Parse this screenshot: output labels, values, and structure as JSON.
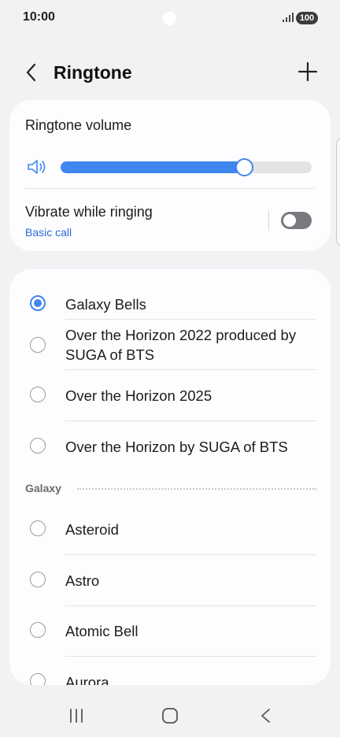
{
  "status": {
    "time": "10:00",
    "battery": "100"
  },
  "header": {
    "title": "Ringtone",
    "back_icon": "chevron-left-icon",
    "add_icon": "plus-icon"
  },
  "volume_card": {
    "volume_label": "Ringtone volume",
    "volume_level_percent": 73,
    "vibrate_label": "Vibrate while ringing",
    "vibrate_sublabel": "Basic call",
    "vibrate_enabled": false
  },
  "ringtones": {
    "top_items": [
      {
        "label": "Galaxy Bells",
        "selected": true
      },
      {
        "label": "Over the Horizon 2022 produced by SUGA of BTS",
        "selected": false
      },
      {
        "label": "Over the Horizon 2025",
        "selected": false
      },
      {
        "label": "Over the Horizon by SUGA of BTS",
        "selected": false
      }
    ],
    "section_label": "Galaxy",
    "galaxy_items": [
      {
        "label": "Asteroid",
        "selected": false
      },
      {
        "label": "Astro",
        "selected": false
      },
      {
        "label": "Atomic Bell",
        "selected": false
      },
      {
        "label": "Aurora",
        "selected": false
      }
    ]
  },
  "colors": {
    "accent": "#3f86f0",
    "link": "#2a6bd6",
    "background": "#f2f2f5",
    "card": "#fdfdff"
  },
  "nav": {
    "recents_icon": "recents-icon",
    "home_icon": "home-icon",
    "back_icon": "back-icon"
  }
}
